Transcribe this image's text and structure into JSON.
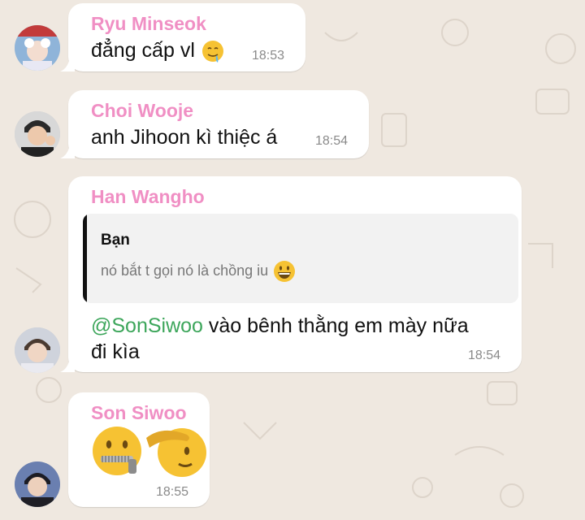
{
  "chat": {
    "messages": [
      {
        "sender": "Ryu Minseok",
        "text": "đẳng cấp vl",
        "time": "18:53",
        "emoji": "drooling-face-emoji"
      },
      {
        "sender": "Choi Wooje",
        "text": "anh Jihoon kì thiệc á",
        "time": "18:54"
      },
      {
        "sender": "Han Wangho",
        "quote": {
          "author": "Bạn",
          "text": "nó bắt t gọi nó là chồng iu",
          "emoji": "grinning-face-emoji"
        },
        "mention": "@SonSiwoo",
        "text_line1": " vào bênh thằng em mày nữa",
        "text_line2": "đi kìa",
        "time": "18:54"
      },
      {
        "sender": "Son Siwoo",
        "emojis": [
          "zipper-mouth-face-emoji",
          "saluting-face-emoji"
        ],
        "time": "18:55"
      }
    ]
  },
  "colors": {
    "background": "#efe8e0",
    "bubble": "#ffffff",
    "sender_name": "#f08fc4",
    "mention": "#3da65b",
    "timestamp": "#8a8a8a"
  }
}
